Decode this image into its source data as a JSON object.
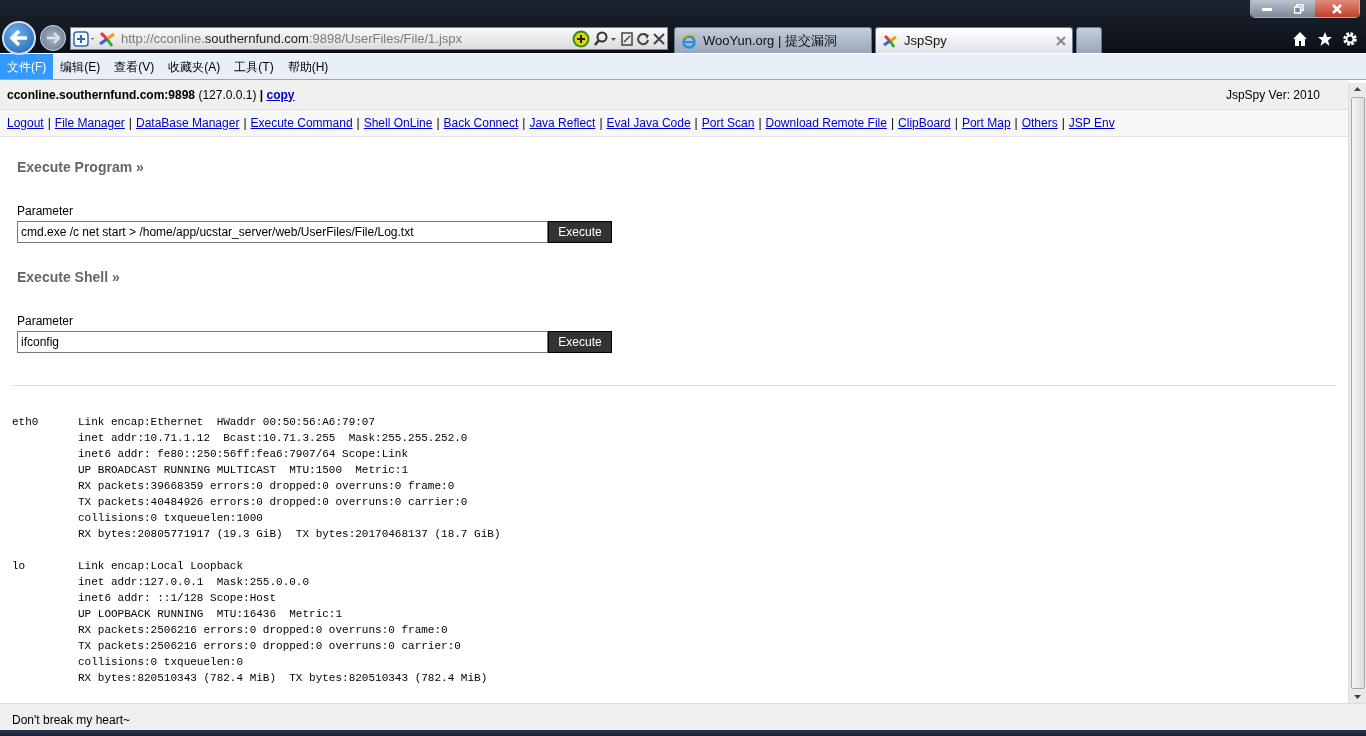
{
  "browser": {
    "address_parts": [
      {
        "text": "http://cconline.",
        "emphasized": false
      },
      {
        "text": "southernfund.com",
        "emphasized": true
      },
      {
        "text": ":9898/UserFiles/File/1.jspx",
        "emphasized": false
      }
    ],
    "tabs": [
      {
        "label": "WooYun.org | 提交漏洞",
        "selected": false
      },
      {
        "label": "JspSpy",
        "selected": true
      }
    ],
    "menu": [
      {
        "label": "文件(F)",
        "selected": true
      },
      {
        "label": "编辑(E)",
        "selected": false
      },
      {
        "label": "查看(V)",
        "selected": false
      },
      {
        "label": "收藏夹(A)",
        "selected": false
      },
      {
        "label": "工具(T)",
        "selected": false
      },
      {
        "label": "帮助(H)",
        "selected": false
      }
    ]
  },
  "page": {
    "host_info": "**cconline.southernfund.com:9898** (127.0.0.1) **|**",
    "copy_link": "copy",
    "version": "JspSpy Ver: 2010",
    "nav": [
      {
        "kind": "link",
        "label": "Logout"
      },
      {
        "kind": "separator",
        "label": "|"
      },
      {
        "kind": "link",
        "label": "File Manager"
      },
      {
        "kind": "separator",
        "label": "|"
      },
      {
        "kind": "link",
        "label": "DataBase Manager"
      },
      {
        "kind": "separator",
        "label": "|"
      },
      {
        "kind": "link",
        "label": "Execute Command"
      },
      {
        "kind": "separator",
        "label": "|"
      },
      {
        "kind": "link",
        "label": "Shell OnLine"
      },
      {
        "kind": "separator",
        "label": "|"
      },
      {
        "kind": "link",
        "label": "Back Connect"
      },
      {
        "kind": "separator",
        "label": "|"
      },
      {
        "kind": "link",
        "label": "Java Reflect"
      },
      {
        "kind": "separator",
        "label": "|"
      },
      {
        "kind": "link",
        "label": "Eval Java Code"
      },
      {
        "kind": "separator",
        "label": "|"
      },
      {
        "kind": "link",
        "label": "Port Scan"
      },
      {
        "kind": "separator",
        "label": "|"
      },
      {
        "kind": "link",
        "label": "Download Remote File"
      },
      {
        "kind": "separator",
        "label": "|"
      },
      {
        "kind": "link",
        "label": "ClipBoard"
      },
      {
        "kind": "separator",
        "label": "|"
      },
      {
        "kind": "link",
        "label": "Port Map"
      },
      {
        "kind": "separator",
        "label": "|"
      },
      {
        "kind": "link",
        "label": "Others"
      },
      {
        "kind": "separator",
        "label": "|"
      },
      {
        "kind": "link",
        "label": "JSP Env"
      }
    ],
    "sections": [
      {
        "title": "Execute Program »",
        "label": "Parameter",
        "value": "cmd.exe /c net start > /home/app/ucstar_server/web/UserFiles/File/Log.txt",
        "button": "Execute"
      },
      {
        "title": "Execute Shell »",
        "label": "Parameter",
        "value": "ifconfig",
        "button": "Execute"
      }
    ],
    "output": "eth0      Link encap:Ethernet  HWaddr 00:50:56:A6:79:07\n          inet addr:10.71.1.12  Bcast:10.71.3.255  Mask:255.255.252.0\n          inet6 addr: fe80::250:56ff:fea6:7907/64 Scope:Link\n          UP BROADCAST RUNNING MULTICAST  MTU:1500  Metric:1\n          RX packets:39668359 errors:0 dropped:0 overruns:0 frame:0\n          TX packets:40484926 errors:0 dropped:0 overruns:0 carrier:0\n          collisions:0 txqueuelen:1000\n          RX bytes:20805771917 (19.3 GiB)  TX bytes:20170468137 (18.7 GiB)\n\nlo        Link encap:Local Loopback\n          inet addr:127.0.0.1  Mask:255.0.0.0\n          inet6 addr: ::1/128 Scope:Host\n          UP LOOPBACK RUNNING  MTU:16436  Metric:1\n          RX packets:2506216 errors:0 dropped:0 overruns:0 frame:0\n          TX packets:2506216 errors:0 dropped:0 overruns:0 carrier:0\n          collisions:0 txqueuelen:0\n          RX bytes:820510343 (782.4 MiB)  TX bytes:820510343 (782.4 MiB)",
    "footer": "Don't break my heart~"
  }
}
